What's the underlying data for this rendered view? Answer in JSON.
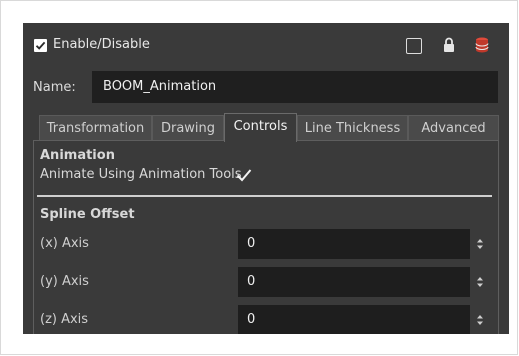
{
  "header": {
    "enable_label": "Enable/Disable",
    "enable_checked": true,
    "icons": [
      "option-box-icon",
      "lock-icon",
      "database-icon"
    ]
  },
  "name": {
    "label": "Name:",
    "value": "BOOM_Animation"
  },
  "tabs": [
    {
      "label": "Transformation",
      "active": false
    },
    {
      "label": "Drawing",
      "active": false
    },
    {
      "label": "Controls",
      "active": true
    },
    {
      "label": "Line Thickness",
      "active": false
    },
    {
      "label": "Advanced",
      "active": false
    }
  ],
  "animation": {
    "title": "Animation",
    "option_label": "Animate Using Animation Tools",
    "option_checked": true
  },
  "spline_offset": {
    "title": "Spline Offset",
    "axes": [
      {
        "label": "(x) Axis",
        "value": "0"
      },
      {
        "label": "(y) Axis",
        "value": "0"
      },
      {
        "label": "(z) Axis",
        "value": "0"
      }
    ]
  },
  "colors": {
    "panel_bg": "#3a3a3a",
    "field_bg": "#1f1f1f",
    "accent_red": "#c0392b"
  }
}
